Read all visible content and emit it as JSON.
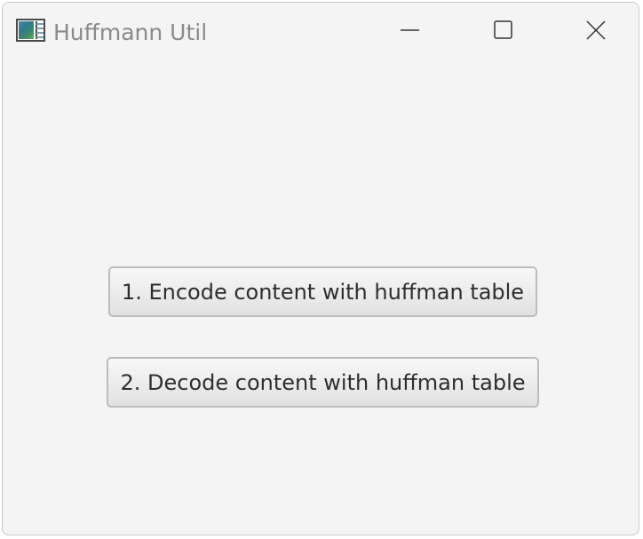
{
  "window": {
    "title": "Huffmann Util",
    "controls": {
      "minimize": "minimize-icon",
      "maximize": "maximize-icon",
      "close": "close-icon"
    }
  },
  "actions": {
    "encode_label": "1. Encode content with huffman table",
    "decode_label": "2. Decode content with huffman table"
  },
  "colors": {
    "window_background": "#f4f4f4",
    "title_text": "#8a8a8a",
    "button_border": "#bcbcbc",
    "button_text": "#2e2e2e"
  }
}
